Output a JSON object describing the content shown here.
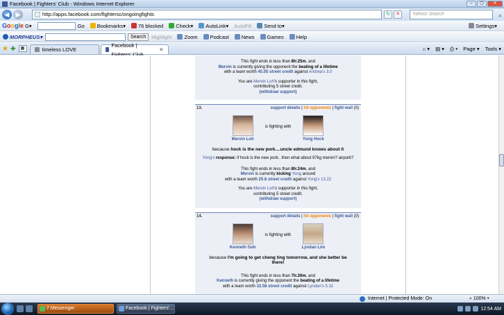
{
  "window": {
    "title": "Facebook | Fighters' Club - Windows Internet Explorer"
  },
  "address": {
    "url": "http://apps.facebook.com/fightersc/ongoingfights",
    "search_placeholder": "Yahoo! Search"
  },
  "google_bar": {
    "logo": "Google",
    "g_label": "G",
    "go": "Go",
    "bookmarks": "Bookmarks",
    "blocked": "76 blocked",
    "check": "Check",
    "autolink": "AutoLink",
    "autofill": "AutoFill",
    "sendto": "Send to",
    "settings": "Settings"
  },
  "morpheus_bar": {
    "logo": "MORPHEUS",
    "search": "Search",
    "highlight": "Highlight",
    "zoom": "Zoom",
    "podcast": "Podcast",
    "news": "News",
    "games": "Games",
    "help": "Help"
  },
  "tabs": [
    {
      "label": "timeless LOVE",
      "active": false
    },
    {
      "label": "Facebook | Fighters' Club",
      "active": true
    }
  ],
  "tab_tools": {
    "page": "Page",
    "tools": "Tools"
  },
  "fight_top": {
    "ends_a": "This fight ends in less than ",
    "ends_time": "8h:25m",
    "ends_b": ", and",
    "fighter": "Mervin",
    "mid": " is currently giving the opponent the ",
    "action": "beating of a lifetime",
    "worth_a": "with a team worth ",
    "credit": "45.05 street credit",
    "worth_b": " against ",
    "against": "Andrea's 3.0",
    "sup_a": "You are ",
    "sup_name": "Mervin Loh",
    "sup_b": "'s supporter in this fight,",
    "contrib": "contributing 5 street credit.",
    "withdraw": "(withdraw support)"
  },
  "fight13": {
    "num": "13.",
    "support": "support details",
    "hit": "hit opponents",
    "wall": "fight wall",
    "wall_count": "(0)",
    "p1": "Mervin Loh",
    "vs": "is fighting with",
    "p2": "Yong Hock",
    "because": "because ",
    "reason": "hock is the new pork....uncle edmund knows about it",
    "resp_name": "Yong's",
    "resp_label": " response:",
    "resp_text": " if hock is the new pork.. then what about 97kg mervin? airpork?",
    "ends_a": "This fight ends in less than ",
    "ends_time": "8h:24m",
    "ends_b": ", and",
    "fighter": "Mervin",
    "mid": " is currently ",
    "action": "kicking",
    "opp": " Yong",
    "mid2": " around",
    "worth_a": "with a team worth ",
    "credit": "25.8 street credit",
    "worth_b": " against ",
    "against": "Yong's 13.22",
    "sup_a": "You are ",
    "sup_name": "Mervin Loh",
    "sup_b": "'s supporter in this fight,",
    "contrib": "contributing 5 street credit.",
    "withdraw": "(withdraw support)"
  },
  "fight14": {
    "num": "14.",
    "support": "support details",
    "hit": "hit opponents",
    "wall": "fight wall",
    "wall_count": "(0)",
    "p1": "Kenneth Goh",
    "vs": "is fighting with",
    "p2": "Lyndan Lim",
    "because": "because ",
    "reason": "I'm going to get cheng ting tomorrow, and she better be there!",
    "ends_a": "This fight ends in less than ",
    "ends_time": "7h:26m",
    "ends_b": ", and",
    "fighter": "Kenneth",
    "mid": " is currently giving the opponent the ",
    "action": "beating of a lifetime",
    "worth_a": "with a team worth ",
    "credit": "32.58 street credit",
    "worth_b": " against ",
    "against": "Lyndan's 5.32"
  },
  "status": {
    "zone": "Internet | Protected Mode: On",
    "zoom": "100%"
  },
  "taskbar": {
    "messenger": "7 Messenger",
    "ie": "Facebook | Fighters'...",
    "clock": "12:54 AM"
  }
}
